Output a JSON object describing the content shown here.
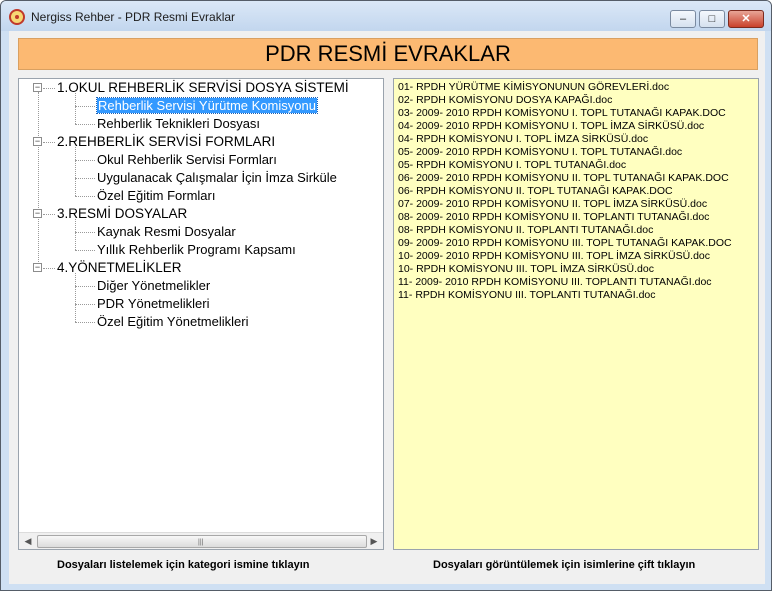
{
  "window": {
    "title": "Nergiss Rehber - PDR Resmi Evraklar",
    "min_label": "–",
    "max_label": "□",
    "close_label": "✕"
  },
  "header": {
    "title": "PDR RESMİ EVRAKLAR"
  },
  "tree": {
    "categories": [
      {
        "label": "1.OKUL REHBERLİK SERVİSİ DOSYA SİSTEMİ",
        "expander": "−",
        "items": [
          "Rehberlik Servisi Yürütme Komisyonu",
          "Rehberlik Teknikleri Dosyası"
        ]
      },
      {
        "label": "2.REHBERLİK SERVİSİ FORMLARI",
        "expander": "−",
        "items": [
          "Okul Rehberlik Servisi Formları",
          "Uygulanacak Çalışmalar İçin İmza Sirküle",
          "Özel Eğitim Formları"
        ]
      },
      {
        "label": "3.RESMİ DOSYALAR",
        "expander": "−",
        "items": [
          "Kaynak Resmi Dosyalar",
          "Yıllık Rehberlik Programı Kapsamı"
        ]
      },
      {
        "label": "4.YÖNETMELİKLER",
        "expander": "−",
        "items": [
          "Diğer Yönetmelikler",
          "PDR Yönetmelikleri",
          "Özel Eğitim Yönetmelikleri"
        ]
      }
    ],
    "selected": "Rehberlik Servisi Yürütme Komisyonu",
    "scroll_left": "◀",
    "scroll_right": "▶",
    "scroll_grip": "|||"
  },
  "files": [
    "01- RPDH YÜRÜTME KİMİSYONUNUN GÖREVLERİ.doc",
    "02- RPDH KOMİSYONU DOSYA KAPAĞI.doc",
    "03- 2009- 2010 RPDH KOMİSYONU I. TOPL TUTANAĞI KAPAK.DOC",
    "04- 2009- 2010 RPDH KOMİSYONU I. TOPL İMZA SİRKÜSÜ.doc",
    "04- RPDH KOMİSYONU I. TOPL İMZA SİRKÜSÜ.doc",
    "05- 2009- 2010 RPDH KOMİSYONU I. TOPL TUTANAĞI.doc",
    "05- RPDH KOMİSYONU I. TOPL TUTANAĞI.doc",
    "06- 2009- 2010 RPDH KOMİSYONU II. TOPL TUTANAĞI KAPAK.DOC",
    "06- RPDH KOMİSYONU II. TOPL TUTANAĞI KAPAK.DOC",
    "07- 2009- 2010 RPDH KOMİSYONU II. TOPL İMZA SİRKÜSÜ.doc",
    "08- 2009- 2010 RPDH KOMİSYONU II. TOPLANTI TUTANAĞI.doc",
    "08- RPDH KOMİSYONU II. TOPLANTI TUTANAĞI.doc",
    "09- 2009- 2010 RPDH KOMİSYONU III. TOPL TUTANAĞI KAPAK.DOC",
    "10- 2009- 2010 RPDH KOMİSYONU III. TOPL İMZA SİRKÜSÜ.doc",
    "10- RPDH KOMİSYONU III. TOPL İMZA SİRKÜSÜ.doc",
    "11- 2009- 2010 RPDH KOMİSYONU III. TOPLANTI TUTANAĞI.doc",
    "11- RPDH KOMİSYONU III. TOPLANTI TUTANAĞI.doc"
  ],
  "hints": {
    "left": "Dosyaları listelemek için kategori ismine tıklayın",
    "right": "Dosyaları görüntülemek için isimlerine çift tıklayın"
  }
}
